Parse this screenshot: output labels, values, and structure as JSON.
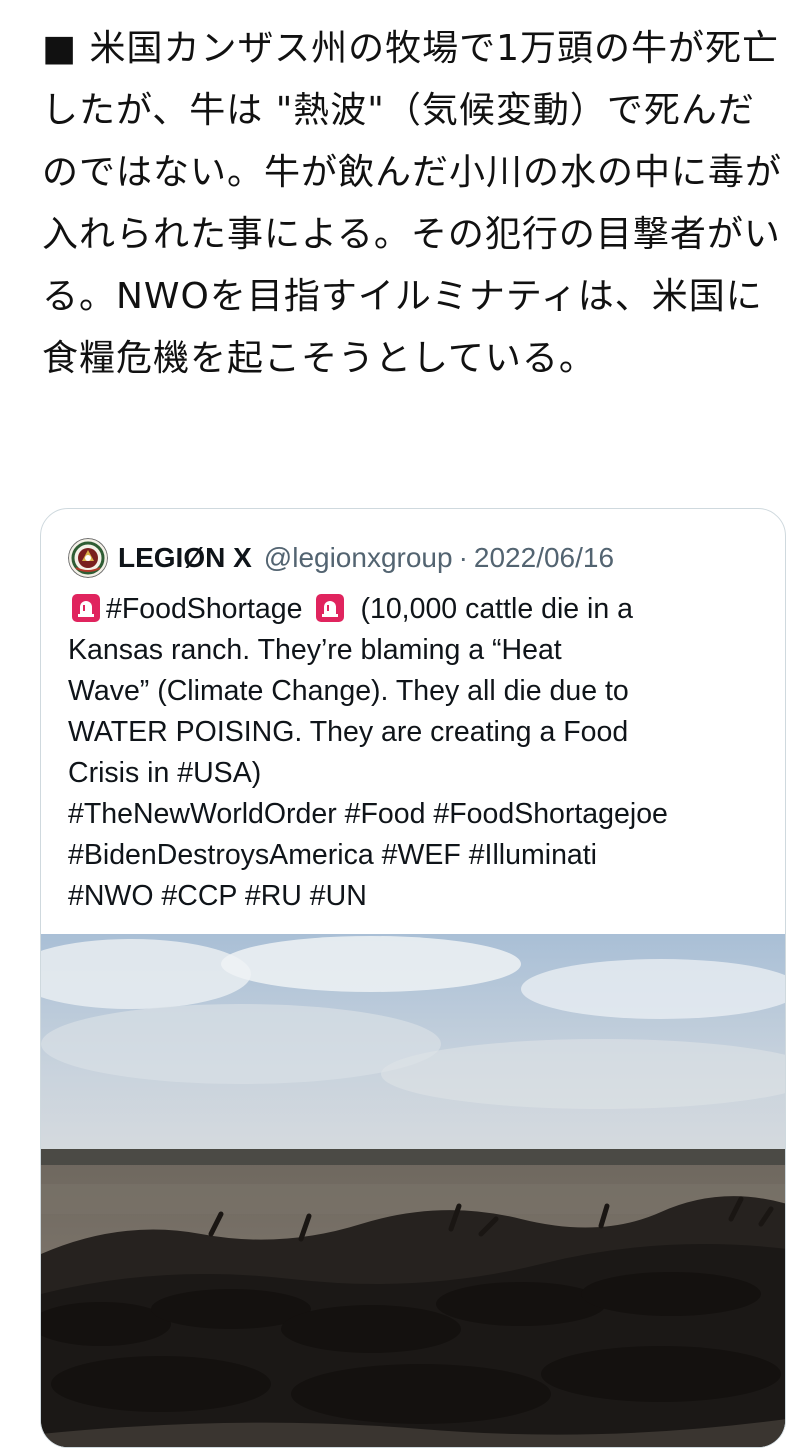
{
  "tweet": {
    "bullet": "■",
    "text": " 米国カンザス州の牧場で1万頭の牛が死亡したが、牛は \"熱波\"（気候変動）で死んだのではない。牛が飲んだ小川の水の中に毒が入れられた事による。その犯行の目撃者がいる。NWOを目指すイルミナティは、米国に食糧危機を起こそうとしている。"
  },
  "quote": {
    "author_name": "LEGIØN X",
    "handle": "@legionxgroup",
    "separator": "·",
    "date": "2022/06/16",
    "avatar_icon": "legion-emblem-icon",
    "siren_icon": "rotating-light-icon",
    "body_lines": {
      "l1_tag": "#FoodShortage",
      "l1_rest": "(10,000 cattle die in a",
      "l2": "Kansas ranch. They’re blaming a “Heat",
      "l3": "Wave” (Climate Change). They all die due to",
      "l4": "WATER POISING. They are creating a Food",
      "l5": "Crisis in #USA)",
      "l6": "#TheNewWorldOrder #Food #FoodShortagejoe",
      "l7": "#BidenDestroysAmerica #WEF #Illuminati",
      "l8": "#NWO #CCP #RU #UN"
    },
    "media": {
      "type": "photo",
      "scene": "dead-cattle-field"
    }
  },
  "colors": {
    "text": "#0f1419",
    "secondary": "#536471",
    "border": "#cfd9de",
    "siren": "#e0245e"
  }
}
